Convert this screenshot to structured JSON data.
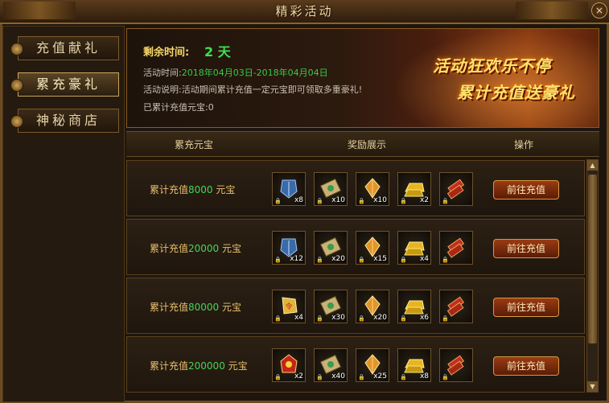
{
  "window": {
    "title": "精彩活动",
    "close": "×"
  },
  "sidebar": {
    "items": [
      {
        "label": "充值献礼",
        "active": false
      },
      {
        "label": "累充豪礼",
        "active": true
      },
      {
        "label": "神秘商店",
        "active": false
      }
    ]
  },
  "banner": {
    "remaining_label": "剩余时间:",
    "remaining_value": "2 天",
    "time_label": "活动时间:",
    "time_value": "2018年04月03日-2018年04月04日",
    "desc_label": "活动说明:",
    "desc_value": "活动期间累计充值一定元宝即可领取多重豪礼!",
    "recharged_label": "已累计充值元宝:",
    "recharged_value": "0",
    "slogan_line1": "活动狂欢乐不停",
    "slogan_line2": "累计充值送豪礼"
  },
  "table": {
    "headers": [
      "累充元宝",
      "奖励展示",
      "操作"
    ],
    "rows": [
      {
        "prefix": "累计充值",
        "amount": "8000",
        "suffix": "元宝",
        "button": "前往充值",
        "items": [
          {
            "icon": "armor-icon",
            "qty": "x8"
          },
          {
            "icon": "scroll-icon",
            "qty": "x10"
          },
          {
            "icon": "crystal-icon",
            "qty": "x10"
          },
          {
            "icon": "gold-bar-icon",
            "qty": "x2"
          },
          {
            "icon": "firecracker-icon",
            "qty": ""
          }
        ]
      },
      {
        "prefix": "累计充值",
        "amount": "20000",
        "suffix": "元宝",
        "button": "前往充值",
        "items": [
          {
            "icon": "armor-icon",
            "qty": "x12"
          },
          {
            "icon": "scroll-icon",
            "qty": "x20"
          },
          {
            "icon": "crystal-icon",
            "qty": "x15"
          },
          {
            "icon": "gold-bar-icon",
            "qty": "x4"
          },
          {
            "icon": "firecracker-icon",
            "qty": ""
          }
        ]
      },
      {
        "prefix": "累计充值",
        "amount": "80000",
        "suffix": "元宝",
        "button": "前往充值",
        "items": [
          {
            "icon": "token-icon",
            "qty": "x4"
          },
          {
            "icon": "scroll-icon",
            "qty": "x30"
          },
          {
            "icon": "crystal-icon",
            "qty": "x20"
          },
          {
            "icon": "gold-bar-icon",
            "qty": "x6"
          },
          {
            "icon": "firecracker-icon",
            "qty": ""
          }
        ]
      },
      {
        "prefix": "累计充值",
        "amount": "200000",
        "suffix": "元宝",
        "button": "前往充值",
        "items": [
          {
            "icon": "red-token-icon",
            "qty": "x2"
          },
          {
            "icon": "scroll-icon",
            "qty": "x40"
          },
          {
            "icon": "crystal-icon",
            "qty": "x25"
          },
          {
            "icon": "gold-bar-icon",
            "qty": "x8"
          },
          {
            "icon": "firecracker-icon",
            "qty": ""
          }
        ]
      }
    ]
  },
  "colors": {
    "accent_gold": "#f5d76a",
    "green": "#3fe050",
    "border": "#8a6428"
  }
}
